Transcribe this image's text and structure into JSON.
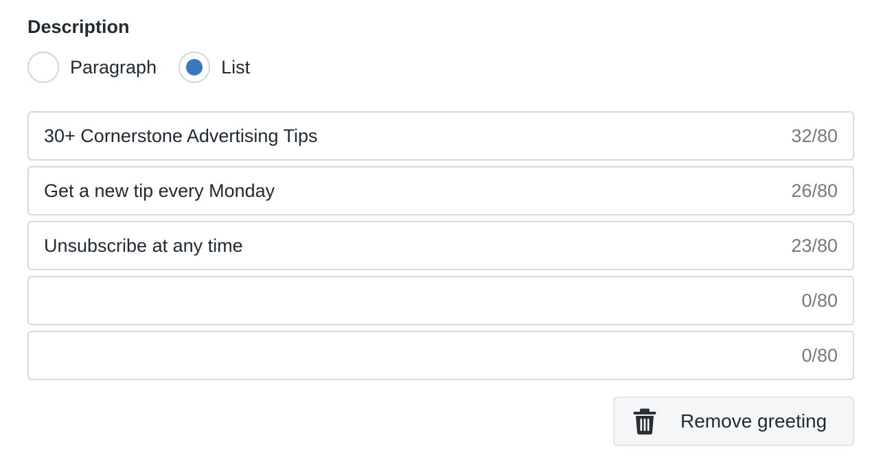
{
  "description": {
    "title": "Description",
    "mode_options": [
      {
        "label": "Paragraph",
        "selected": false
      },
      {
        "label": "List",
        "selected": true
      }
    ]
  },
  "list_items": [
    {
      "value": "30+ Cornerstone Advertising Tips",
      "counter": "32/80"
    },
    {
      "value": "Get a new tip every Monday",
      "counter": "26/80"
    },
    {
      "value": "Unsubscribe at any time",
      "counter": "23/80"
    },
    {
      "value": "",
      "counter": "0/80"
    },
    {
      "value": "",
      "counter": "0/80"
    }
  ],
  "actions": {
    "remove_label": "Remove greeting",
    "remove_icon": "trash-icon"
  },
  "colors": {
    "accent": "#3b78c2",
    "border": "#d6d9dc",
    "text": "#1f2933",
    "muted": "#75797d"
  }
}
